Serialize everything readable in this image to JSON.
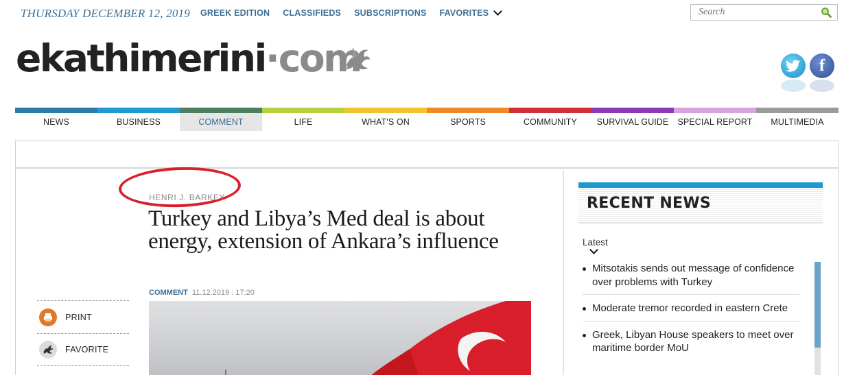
{
  "topbar": {
    "date": "THURSDAY DECEMBER 12, 2019",
    "links": [
      "GREEK EDITION",
      "CLASSIFIEDS",
      "SUBSCRIPTIONS"
    ],
    "favorites": "FAVORITES",
    "search_placeholder": "Search"
  },
  "logo": {
    "main": "ekathimerini",
    "dot": "·",
    "com": "com"
  },
  "social": {
    "twitter_glyph": "t",
    "facebook_glyph": "f"
  },
  "nav": {
    "items": [
      {
        "label": "NEWS",
        "color": "#2e7aa8"
      },
      {
        "label": "BUSINESS",
        "color": "#1f9ad6"
      },
      {
        "label": "COMMENT",
        "color": "#4d7e62"
      },
      {
        "label": "LIFE",
        "color": "#b5d13b"
      },
      {
        "label": "WHAT'S ON",
        "color": "#f2c32b"
      },
      {
        "label": "SPORTS",
        "color": "#ee8a2a"
      },
      {
        "label": "COMMUNITY",
        "color": "#d12f3a"
      },
      {
        "label": "SURVIVAL GUIDE",
        "color": "#8a3bb8"
      },
      {
        "label": "SPECIAL REPORT",
        "color": "#d8a4e0"
      },
      {
        "label": "MULTIMEDIA",
        "color": "#9a9a9a"
      }
    ],
    "active": "COMMENT"
  },
  "article": {
    "author": "HENRI J. BARKEY",
    "headline": "Turkey and Libya’s Med deal is about energy, extension of Ankara’s influence",
    "category": "COMMENT",
    "date": "11.12.2019 : 17:20"
  },
  "tools": {
    "print": "PRINT",
    "favorite": "FAVORITE"
  },
  "sidebar": {
    "title": "RECENT NEWS",
    "tab": "Latest",
    "news": [
      "Mitsotakis sends out message of confidence over problems with Turkey",
      "Moderate tremor recorded in eastern Crete",
      "Greek, Libyan House speakers to meet over maritime border MoU"
    ]
  },
  "colors": {
    "accent": "#3a6e96",
    "annotation_circle": "#d8202a",
    "sidebar_bar": "#1f97cf"
  }
}
